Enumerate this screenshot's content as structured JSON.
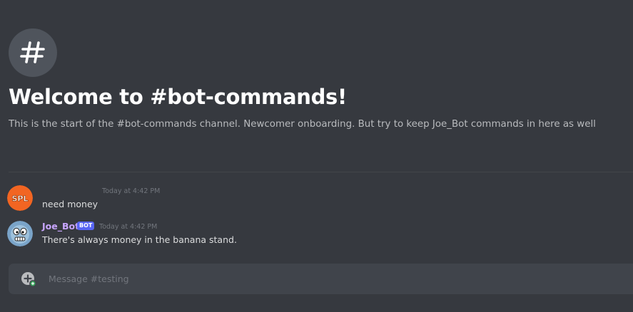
{
  "channel": {
    "welcome_title": "Welcome to #bot-commands!",
    "welcome_description": "This is the start of the #bot-commands channel. Newcomer onboarding. But try to keep Joe_Bot commands in here as well",
    "icon": "hash-icon"
  },
  "messages": [
    {
      "author": "",
      "avatar": "spl-avatar",
      "avatar_text": "SPL",
      "avatar_color": "#f26522",
      "timestamp": "Today at 4:42 PM",
      "content": "need money"
    },
    {
      "author": "Joe_Bot",
      "author_color": "#c9a6ff",
      "tag": "BOT",
      "tag_color": "#5865f2",
      "avatar": "bot-face-avatar",
      "timestamp": "Today at 4:42 PM",
      "content": "There's always money in the banana stand."
    }
  ],
  "composer": {
    "placeholder": "Message #testing",
    "attach_icon": "plus-circle-icon"
  },
  "colors": {
    "background": "#36393f",
    "composer": "#40444b",
    "muted_text": "#72767d",
    "description_text": "#b9bbbe"
  }
}
